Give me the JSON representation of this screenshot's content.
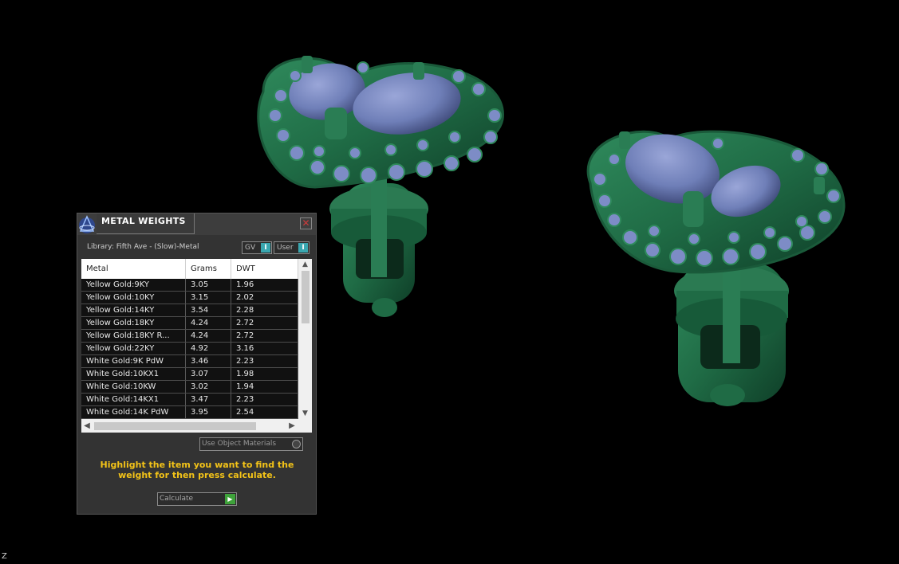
{
  "window": {
    "title": "METAL WEIGHTS",
    "close_glyph": "✕",
    "logo_icon": "rhino-logo-icon"
  },
  "library": {
    "label": "Library: Fifth Ave - (Slow)-Metal",
    "gv_label": "GV",
    "user_label": "User",
    "toggle_glyph": "I"
  },
  "table": {
    "columns": [
      "Metal",
      "Grams",
      "DWT"
    ],
    "rows": [
      [
        "Yellow Gold:9KY",
        "3.05",
        "1.96"
      ],
      [
        "Yellow Gold:10KY",
        "3.15",
        "2.02"
      ],
      [
        "Yellow Gold:14KY",
        "3.54",
        "2.28"
      ],
      [
        "Yellow Gold:18KY",
        "4.24",
        "2.72"
      ],
      [
        "Yellow Gold:18KY R...",
        "4.24",
        "2.72"
      ],
      [
        "Yellow Gold:22KY",
        "4.92",
        "3.16"
      ],
      [
        "White Gold:9K PdW",
        "3.46",
        "2.23"
      ],
      [
        "White Gold:10KX1",
        "3.07",
        "1.98"
      ],
      [
        "White Gold:10KW",
        "3.02",
        "1.94"
      ],
      [
        "White Gold:14KX1",
        "3.47",
        "2.23"
      ],
      [
        "White Gold:14K PdW",
        "3.95",
        "2.54"
      ]
    ]
  },
  "options": {
    "use_object_materials": "Use Object Materials"
  },
  "hint": "Highlight the item you want to find the weight for then press calculate.",
  "calculate": {
    "label": "Calculate",
    "icon": "play-arrow-icon"
  },
  "viewport": {
    "axis_label": "Z",
    "metal_color": "#1f6b45",
    "gem_color": "#6f7fb8"
  }
}
